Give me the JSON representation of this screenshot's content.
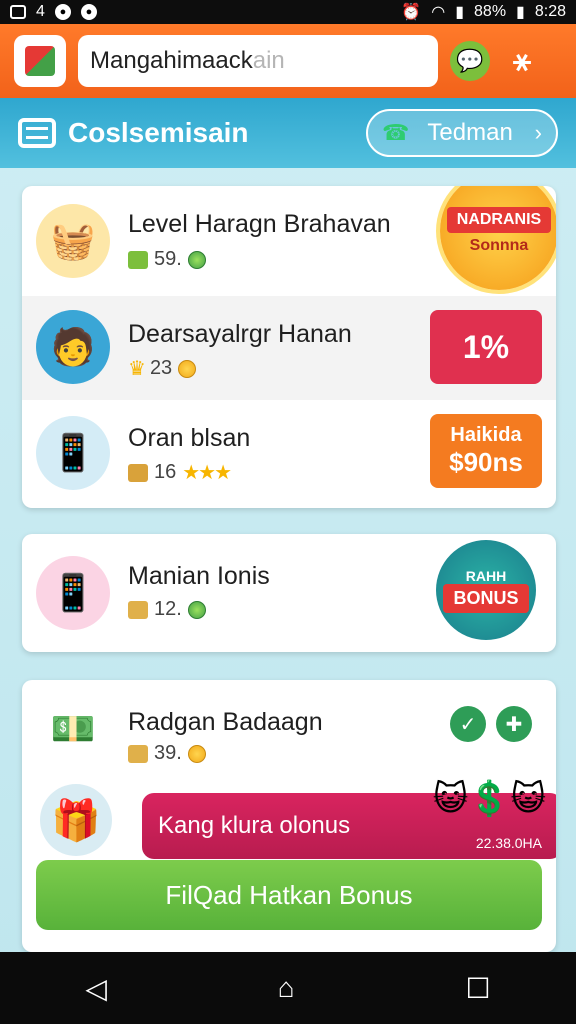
{
  "status_bar": {
    "battery": "88%",
    "time": "8:28"
  },
  "app_bar": {
    "search_value": "Mangahimaack",
    "search_placeholder": "ain",
    "logo_icon": "app-logo-icon",
    "chat_icon": "chat-bubble-icon",
    "share_icon": "share-icon"
  },
  "header": {
    "title": "Coslsemisain",
    "button_label": "Tedman"
  },
  "card1": {
    "rows": [
      {
        "title": "Level Haragn Brahavan",
        "value": "59.",
        "badge_top": "NADRANIS",
        "badge_bottom": "Sonnna"
      },
      {
        "title": "Dearsayalrgr Hanan",
        "value": "23",
        "tile": "1%"
      },
      {
        "title": "Oran blsan",
        "value": "16",
        "stars": "★★★",
        "tile_line1": "Haikida",
        "tile_line2": "$90ns"
      }
    ]
  },
  "card2": {
    "title": "Manian Ionis",
    "value": "12.",
    "badge_top": "RAHH",
    "badge_bottom": "BONUS"
  },
  "card3": {
    "title": "Radgan Badaagn",
    "value": "39.",
    "promo_text": "Kang klura olonus",
    "promo_amount": "22.38.0HA",
    "cta_label": "FilQad Hatkan Bonus"
  },
  "colors": {
    "app_bar": "#f2621a",
    "header": "#2fa7cf",
    "promo": "#c81f56",
    "cta": "#58b23a",
    "tile_red": "#e0304f",
    "tile_orange": "#f47b20"
  }
}
